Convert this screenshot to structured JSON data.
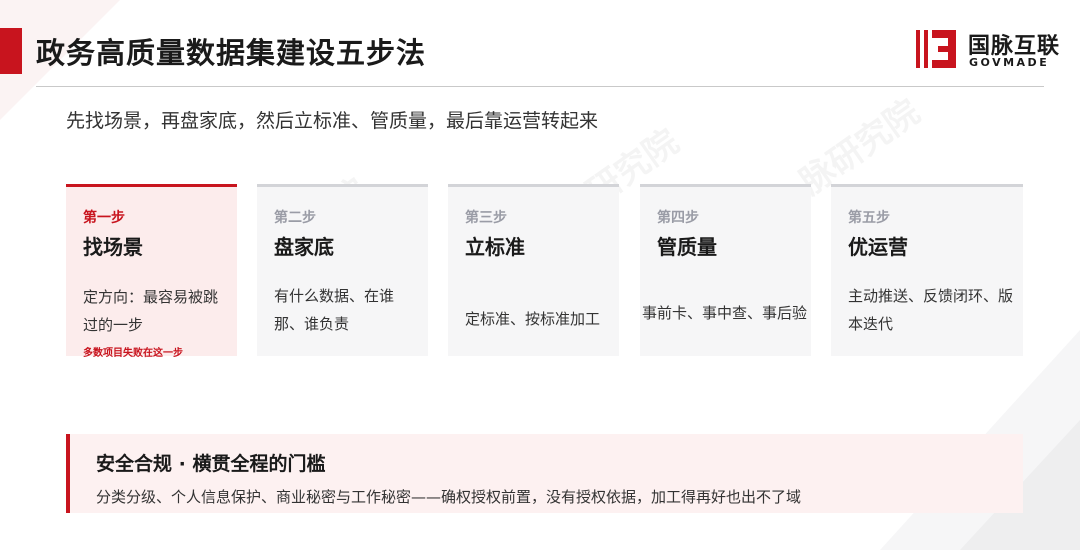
{
  "header": {
    "title": "政务高质量数据集建设五步法",
    "subtitle": "先找场景，再盘家底，然后立标准、管质量，最后靠运营转起来"
  },
  "logo": {
    "name": "国脉互联",
    "sub": "GOVMADE"
  },
  "steps": [
    {
      "step": "第一步",
      "name": "找场景",
      "desc": "定方向：最容易被跳过的一步",
      "note": "多数项目失败在这一步"
    },
    {
      "step": "第二步",
      "name": "盘家底",
      "desc": "有什么数据、在谁那、谁负责"
    },
    {
      "step": "第三步",
      "name": "立标准",
      "desc": "定标准、按标准加工"
    },
    {
      "step": "第四步",
      "name": "管质量",
      "desc": "事前卡、事中查、事后验"
    },
    {
      "step": "第五步",
      "name": "优运营",
      "desc": "主动推送、反馈闭环、版本迭代"
    }
  ],
  "compliance": {
    "heading": "安全合规 · 横贯全程的门槛",
    "body": "分类分级、个人信息保护、商业秘密与工作秘密——确权授权前置，没有授权依据，加工得再好也出不了域"
  },
  "colors": {
    "accent": "#c8141e",
    "card_bg": "#f6f6f7",
    "active_card_bg": "#fcecec",
    "panel_bg": "#fdf1f1"
  }
}
